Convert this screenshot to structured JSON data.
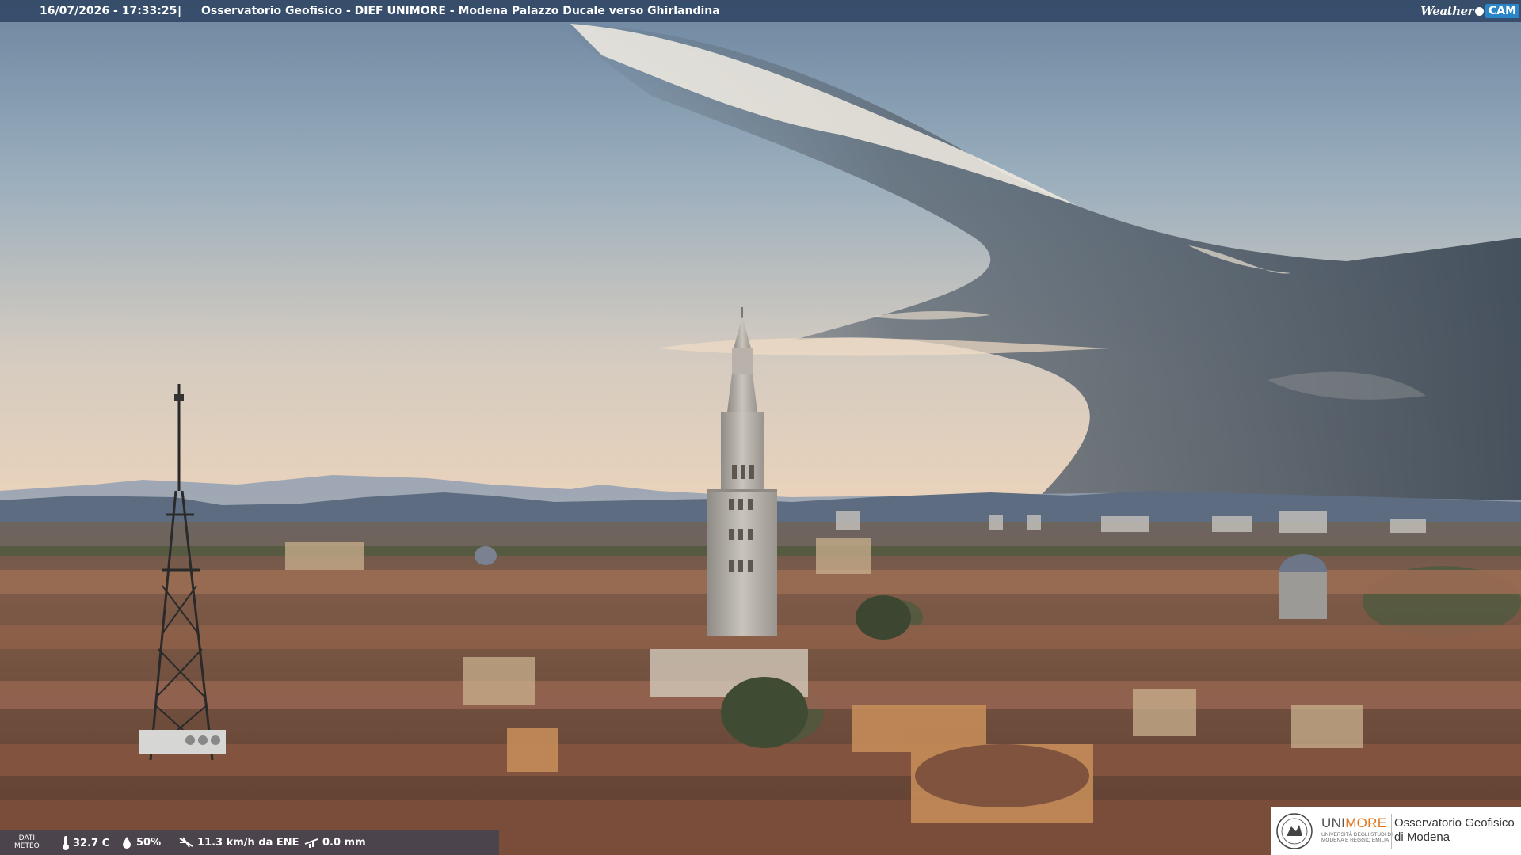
{
  "header": {
    "timestamp": "16/07/2026 - 17:33:25",
    "separator": "|",
    "title": "Osservatorio Geofisico - DIEF UNIMORE - Modena Palazzo Ducale verso Ghirlandina",
    "brand_word": "Weather",
    "brand_box": "CAM"
  },
  "weather": {
    "label_line1": "DATI",
    "label_line2": "METEO",
    "temperature": "32.7 C",
    "humidity": "50%",
    "wind": "11.3 km/h da ENE",
    "rain": "0.0 mm",
    "icons": [
      "thermometer-icon",
      "humidity-icon",
      "wind-icon",
      "rain-gauge-icon"
    ]
  },
  "logo": {
    "uni_part1": "UNI",
    "uni_part2": "MORE",
    "uni_sub": "UNIVERSITÀ DEGLI STUDI DI MODENA E REGGIO EMILIA",
    "obs_line1": "Osservatorio Geofisico",
    "obs_line2": "di Modena"
  },
  "colors": {
    "bar": "#283e5c",
    "sky_top": "#6f8aa3",
    "sky_horizon": "#e9d2b8",
    "storm": "#4a5866",
    "roofs": "#8a5a44",
    "brand_box": "#2a86c9",
    "unimore_orange": "#e0761e"
  }
}
